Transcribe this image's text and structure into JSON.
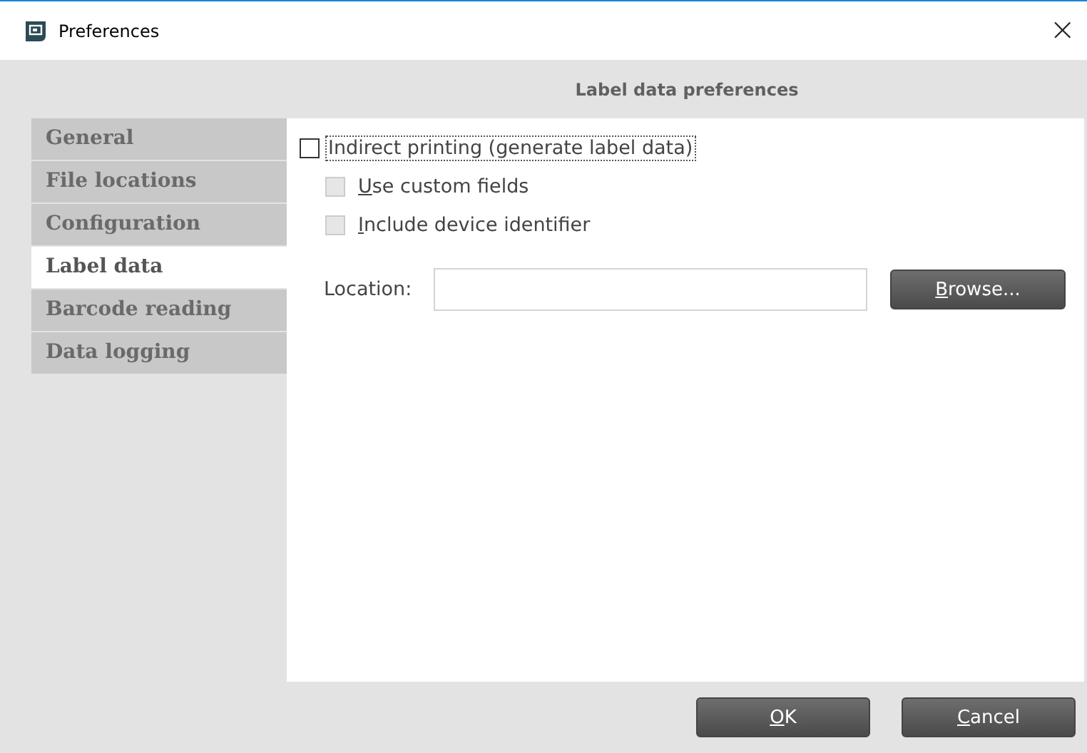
{
  "window": {
    "title": "Preferences",
    "close": "×"
  },
  "header": "Label data preferences",
  "sidebar": {
    "items": [
      {
        "label": "General",
        "selected": false
      },
      {
        "label": "File locations",
        "selected": false
      },
      {
        "label": "Configuration",
        "selected": false
      },
      {
        "label": "Label data",
        "selected": true
      },
      {
        "label": "Barcode reading",
        "selected": false
      },
      {
        "label": "Data logging",
        "selected": false
      }
    ]
  },
  "options": [
    {
      "label": "Indirect printing (generate label data)",
      "checked": false,
      "disabled": false,
      "focused": true,
      "sub": false
    },
    {
      "label": "Use custom fields",
      "checked": false,
      "disabled": true,
      "focused": false,
      "sub": true
    },
    {
      "label": "Include device identifier",
      "checked": false,
      "disabled": true,
      "focused": false,
      "sub": true
    }
  ],
  "location": {
    "label": "Location:",
    "button": "Browse..."
  },
  "buttons": [
    "OK",
    "Cancel"
  ]
}
